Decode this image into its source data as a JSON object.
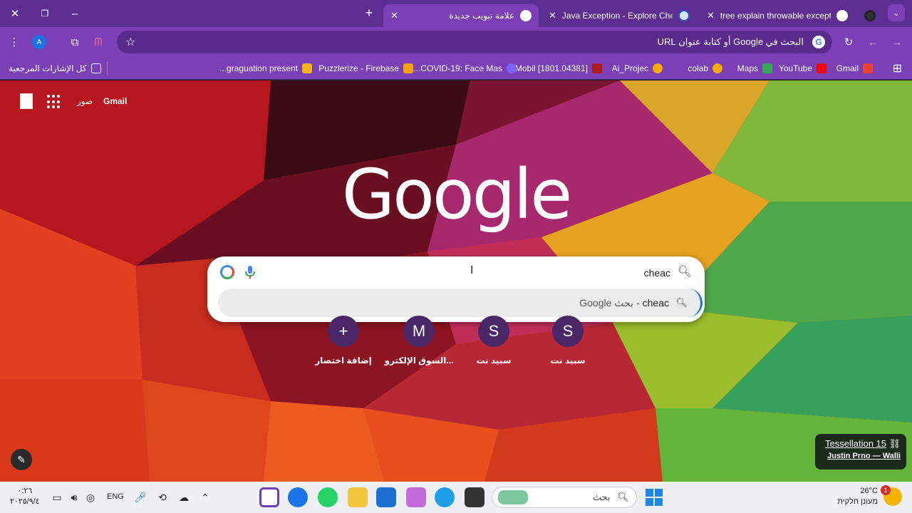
{
  "browser": {
    "tabs": [
      {
        "title": "علامة تبويب جديدة",
        "active": true
      },
      {
        "title": "Java Exception - Explore Checke",
        "active": false
      },
      {
        "title": "tree explain throwable exceptio",
        "active": false
      }
    ],
    "omnibox": {
      "placeholder": "البحث في Google أو كتابة عنوان URL",
      "g_letter": "G"
    },
    "avatar_letter": "A",
    "bookmarks": [
      {
        "label": "Gmail",
        "color": "#ea4335"
      },
      {
        "label": "YouTube",
        "color": "#ff0000"
      },
      {
        "label": "Maps",
        "color": "#34a853"
      },
      {
        "label": "colab",
        "color": "#f9ab00"
      },
      {
        "label": "Ai_Projec",
        "color": "#f9ab00"
      },
      {
        "label": "[1801.04381] Mobil...",
        "color": "#b31b1b"
      },
      {
        "label": "COVID-19: Face Mas...",
        "color": "#7b61ff"
      },
      {
        "label": "Puzzlerize - Firebase",
        "color": "#ffa000"
      },
      {
        "label": "graguation present...",
        "color": "#f4b400"
      }
    ],
    "all_bookmarks": "كل الإشارات المرجعية"
  },
  "ntp": {
    "top_links": {
      "gmail": "Gmail",
      "images": "صور"
    },
    "logo": "Google",
    "search": {
      "query": "cheac",
      "suggestion_query": "cheac",
      "suggestion_separator": "-",
      "suggestion_hint": "بحث Google"
    },
    "shortcuts": [
      {
        "label": "سبيد نت",
        "icon": "S"
      },
      {
        "label": "سبيد نت",
        "icon": "S"
      },
      {
        "label": "السوق الإلكترو...",
        "icon": "M"
      },
      {
        "label": "إضافة اختصار",
        "icon": "+"
      }
    ],
    "attribution": {
      "title": "Tessellation 15",
      "author": "Justin Prno — Walli"
    }
  },
  "taskbar": {
    "time": "٠:٢٦",
    "date": "٢٠٢٥/٩/٤",
    "language": "ENG",
    "search_placeholder": "بحث",
    "weather": {
      "temp": "26°C",
      "desc": "מעונן חלקית",
      "badge": "1"
    }
  },
  "colors": {
    "tab_strip": "#5e2d91",
    "toolbar": "#7b3fb6",
    "accent_blue": "#1a73e8"
  }
}
